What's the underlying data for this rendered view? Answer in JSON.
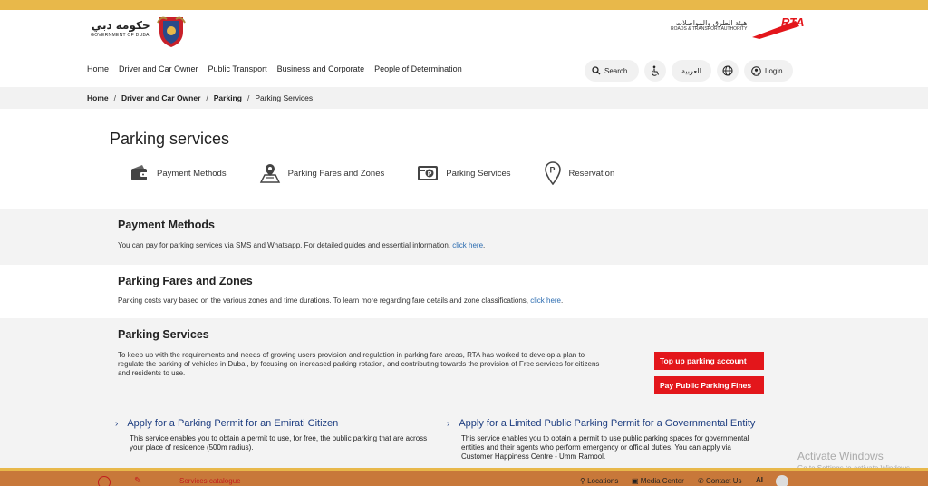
{
  "header": {
    "gov_ar": "حكومة دبي",
    "gov_en": "GOVERNMENT OF DUBAI",
    "rta_ar": "هيئة الطرق والمواصلات",
    "rta_en": "ROADS & TRANSPORT AUTHORITY",
    "rta_mark": "RTA"
  },
  "nav": {
    "items": [
      "Home",
      "Driver and Car Owner",
      "Public Transport",
      "Business and Corporate",
      "People of Determination"
    ]
  },
  "utils": {
    "search_label": "Search..",
    "lang_label": "العربية",
    "login_label": "Login"
  },
  "breadcrumb": [
    "Home",
    "Driver and Car Owner",
    "Parking",
    "Parking Services"
  ],
  "page_title": "Parking services",
  "service_tabs": [
    "Payment Methods",
    "Parking Fares and Zones",
    "Parking Services",
    "Reservation"
  ],
  "sections": {
    "payment": {
      "title": "Payment Methods",
      "text": "You can pay for parking services via SMS and Whatsapp. For detailed guides and essential information, ",
      "link": "click here",
      "tail": "."
    },
    "fares": {
      "title": "Parking Fares and Zones",
      "text": "Parking costs vary based on the various zones and time durations. To learn more regarding fare details and zone classifications, ",
      "link": "click here",
      "tail": "."
    },
    "services": {
      "title": "Parking Services",
      "text": "To keep up with the requirements and needs of growing users provision and regulation in parking fare areas, RTA has worked to develop a plan to regulate the parking of vehicles in Dubai, by focusing on increased parking rotation, and contributing towards the provision of Free services for citizens and residents to use.",
      "btn_topup": "Top up parking account",
      "btn_fines": "Pay Public Parking Fines"
    }
  },
  "permits": [
    {
      "title": "Apply for a Parking Permit for an Emirati Citizen",
      "desc": "This service enables you to obtain a permit to use, for free, the public parking that are across your place of residence (500m radius)."
    },
    {
      "title": "Apply for a Limited Public Parking Permit for a Governmental Entity",
      "desc": "This service enables you to obtain a permit to use public parking spaces for governmental entities and their agents who perform emergency or official duties. You can apply via Customer Happiness Centre - Umm Ramool."
    }
  ],
  "footer": {
    "catalogue": "Services catalogue",
    "locations": "Locations",
    "media": "Media Center",
    "contact": "Contact Us",
    "ai": "AI"
  },
  "watermark": {
    "line1": "Activate Windows",
    "line2": "Go to Settings to activate Windows."
  },
  "colors": {
    "accent_gold": "#e8b84a",
    "button_red": "#e3161b",
    "link_blue": "#2a6bb0",
    "permit_navy": "#1d3d80"
  }
}
